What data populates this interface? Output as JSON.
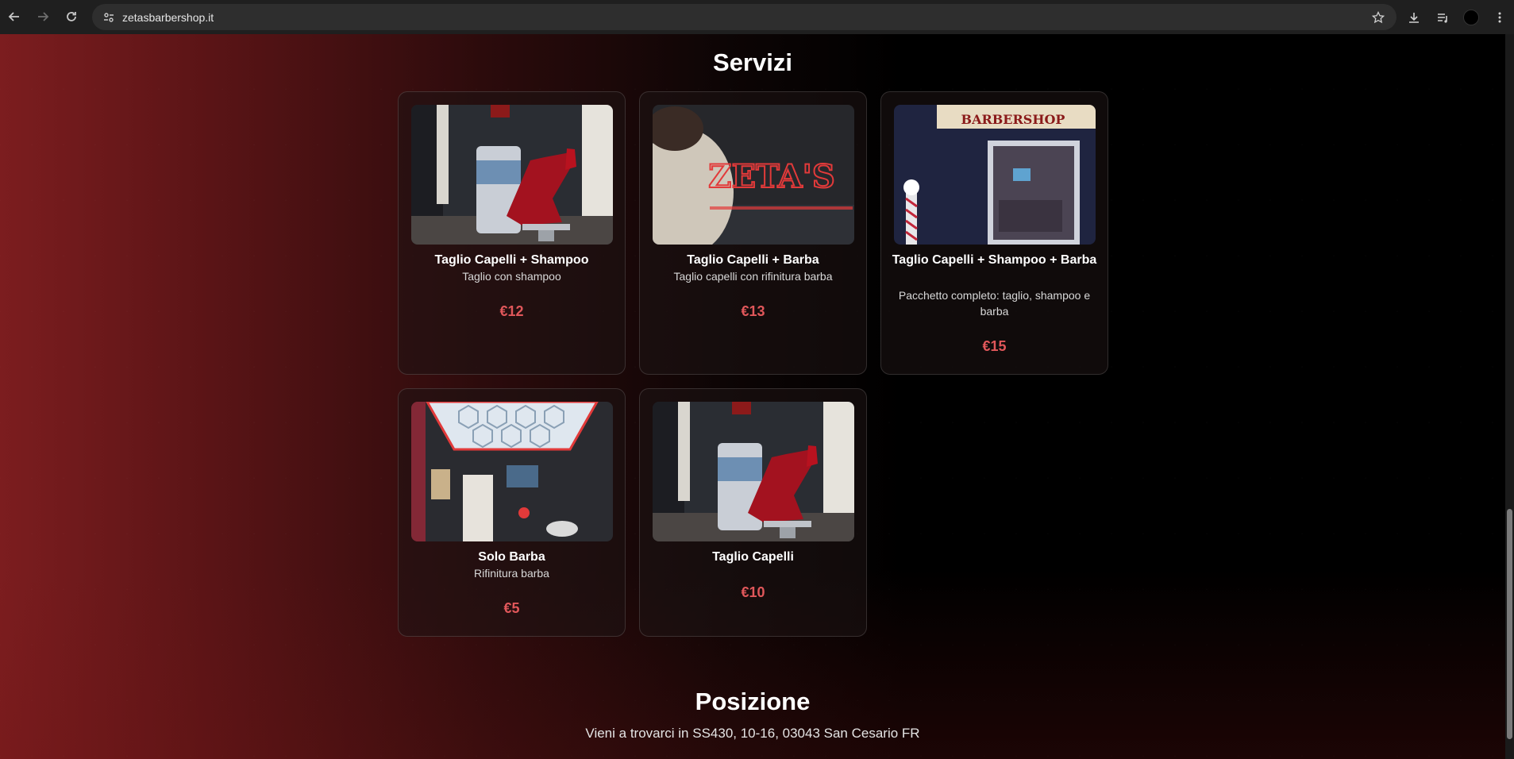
{
  "browser": {
    "url": "zetasbarbershop.it"
  },
  "page": {
    "services_title": "Servizi",
    "services": [
      {
        "name": "Taglio Capelli + Shampoo",
        "description": "Taglio con shampoo",
        "price": "€12",
        "photo_icon": "barber-chair-photo"
      },
      {
        "name": "Taglio Capelli + Barba",
        "description": "Taglio capelli con rifinitura barba",
        "price": "€13",
        "photo_icon": "neon-sign-photo"
      },
      {
        "name": "Taglio Capelli + Shampoo + Barba",
        "description": "Pacchetto completo: taglio, shampoo e barba",
        "price": "€15",
        "photo_icon": "shop-sign-photo"
      },
      {
        "name": "Solo Barba",
        "description": "Rifinitura barba",
        "price": "€5",
        "photo_icon": "hex-ceiling-photo"
      },
      {
        "name": "Taglio Capelli",
        "description": "",
        "price": "€10",
        "photo_icon": "barber-chair-photo"
      }
    ],
    "photo_sign_texts": {
      "neon": "ZETA'S",
      "shop_sign": "BARBERSHOP"
    },
    "position_title": "Posizione",
    "address": "Vieni a trovarci in SS430, 10-16, 03043 San Cesario FR"
  },
  "colors": {
    "accent_price": "#e0575a",
    "bg_red": "#7c1d1f"
  }
}
